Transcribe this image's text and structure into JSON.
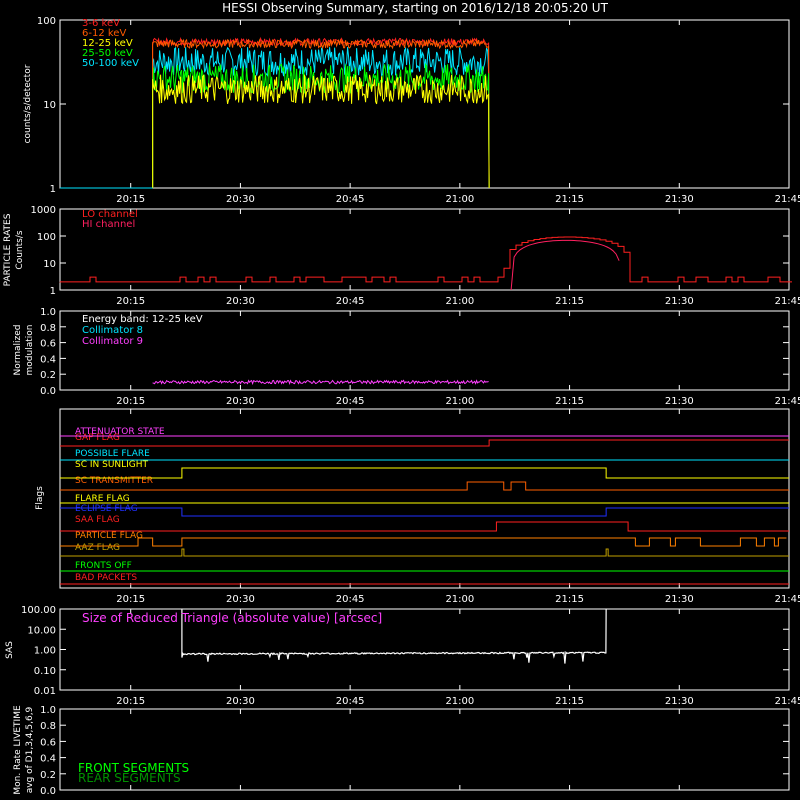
{
  "title": "HESSI Observing Summary, starting on 2016/12/18 20:05:20 UT",
  "colors": {
    "background": "#000000",
    "axes": "#ffffff",
    "e3_6": "#ff2020",
    "e6_12": "#ff5a00",
    "e12_25": "#ffff00",
    "e25_50": "#00ff00",
    "e50_100": "#00e5ff",
    "lo": "#ff2020",
    "hi": "#ff2060",
    "c8": "#00e5ff",
    "c9": "#ff40ff",
    "attenuator": "#ff40ff",
    "gap": "#ff2020",
    "flare_possible": "#00e5ff",
    "sunlight": "#ffff00",
    "transmitter": "#ff6000",
    "flare_flag": "#ffff00",
    "eclipse": "#2030ff",
    "saa": "#ff2020",
    "particle": "#ff8000",
    "aaz": "#c0a000",
    "fronts": "#00ff00",
    "bad": "#ff2020",
    "sas": "#ffffff",
    "sas_label": "#ff40ff",
    "front_seg": "#00ff00",
    "rear_seg": "#009000"
  },
  "time_axis": {
    "ticks": [
      "20:15",
      "20:30",
      "20:45",
      "21:00",
      "21:15",
      "21:30",
      "21:45"
    ]
  },
  "panels": {
    "counts": {
      "ylabel": "counts/s/detector",
      "yticks": [
        "1",
        "10",
        "100"
      ],
      "legend": [
        "3-6 keV",
        "6-12 keV",
        "12-25 keV",
        "25-50 keV",
        "50-100 keV"
      ]
    },
    "particle": {
      "ylabel1": "PARTICLE RATES",
      "ylabel2": "Counts/s",
      "yticks": [
        "1",
        "10",
        "100",
        "1000"
      ],
      "legend": [
        "LO channel",
        "HI channel"
      ]
    },
    "modulation": {
      "ylabel1": "Normalized",
      "ylabel2": "modulation",
      "yticks": [
        "0.0",
        "0.2",
        "0.4",
        "0.6",
        "0.8",
        "1.0"
      ],
      "legend": [
        "Energy band: 12-25 keV",
        "Collimator 8",
        "Collimator 9"
      ]
    },
    "flags": {
      "ylabel": "Flags",
      "names": [
        "ATTENUATOR STATE",
        "GAP FLAG",
        "POSSIBLE FLARE",
        "SC IN SUNLIGHT",
        "SC TRANSMITTER",
        "FLARE FLAG",
        "ECLIPSE FLAG",
        "SAA FLAG",
        "PARTICLE FLAG",
        "AAZ FLAG",
        "FRONTS OFF",
        "BAD PACKETS"
      ]
    },
    "sas": {
      "ylabel": "SAS",
      "yticks": [
        "0.01",
        "0.10",
        "1.00",
        "10.00",
        "100.00"
      ],
      "label": "Size of Reduced Triangle (absolute value) [arcsec]"
    },
    "livetime": {
      "ylabel1": "Mon. Rate LIVETIME",
      "ylabel2": "avg of D1,3,4,5,6,9",
      "yticks": [
        "0.0",
        "0.2",
        "0.4",
        "0.6",
        "0.8",
        "1.0"
      ],
      "legend": [
        "FRONT SEGMENTS",
        "REAR SEGMENTS"
      ]
    }
  },
  "chart_data": [
    {
      "type": "line",
      "title": "HESSI Observing Summary, starting on 2016/12/18 20:05:20 UT",
      "ylabel": "counts/s/detector",
      "yscale": "log",
      "ylim": [
        1,
        100
      ],
      "xlim": [
        "20:05:20",
        "21:45"
      ],
      "series": [
        {
          "name": "3-6 keV",
          "segments": [
            {
              "start": "20:18",
              "end": "21:04",
              "level": 55
            }
          ]
        },
        {
          "name": "6-12 keV",
          "segments": [
            {
              "start": "20:18",
              "end": "21:04",
              "level": 52
            }
          ]
        },
        {
          "name": "12-25 keV",
          "segments": [
            {
              "start": "20:18",
              "end": "21:04",
              "level": 15
            }
          ]
        },
        {
          "name": "25-50 keV",
          "segments": [
            {
              "start": "20:18",
              "end": "21:04",
              "level": 20
            }
          ]
        },
        {
          "name": "50-100 keV",
          "segments": [
            {
              "start": "20:18",
              "end": "21:04",
              "level": 32
            }
          ]
        }
      ]
    },
    {
      "type": "line",
      "ylabel": "PARTICLE RATES Counts/s",
      "yscale": "log",
      "ylim": [
        1,
        1000
      ],
      "series": [
        {
          "name": "LO channel",
          "points": [
            [
              "20:05",
              2
            ],
            [
              "21:03",
              2
            ],
            [
              "21:06",
              5
            ],
            [
              "21:08",
              40
            ],
            [
              "21:11",
              85
            ],
            [
              "21:15",
              90
            ],
            [
              "21:19",
              80
            ],
            [
              "21:22",
              10
            ],
            [
              "21:24",
              2
            ],
            [
              "21:45",
              2
            ]
          ]
        },
        {
          "name": "HI channel",
          "points": [
            [
              "21:06",
              1
            ],
            [
              "21:08",
              15
            ],
            [
              "21:11",
              60
            ],
            [
              "21:15",
              70
            ],
            [
              "21:19",
              60
            ],
            [
              "21:21",
              5
            ],
            [
              "21:22",
              1
            ]
          ]
        }
      ]
    },
    {
      "type": "line",
      "ylabel": "Normalized modulation",
      "ylim": [
        0,
        1
      ],
      "series": [
        {
          "name": "Collimator 8",
          "points": [
            [
              "20:18",
              0.1
            ],
            [
              "21:04",
              0.1
            ]
          ]
        },
        {
          "name": "Collimator 9",
          "points": [
            [
              "20:18",
              0.1
            ],
            [
              "21:04",
              0.1
            ]
          ]
        }
      ]
    },
    {
      "type": "line",
      "ylabel": "SAS",
      "yscale": "log",
      "ylim": [
        0.01,
        100
      ],
      "series": [
        {
          "name": "Size of Reduced Triangle (absolute value) [arcsec]",
          "points": [
            [
              "20:22",
              0.5
            ],
            [
              "20:30",
              0.6
            ],
            [
              "21:00",
              0.65
            ],
            [
              "21:20",
              0.65
            ]
          ]
        }
      ]
    },
    {
      "type": "line",
      "ylabel": "Mon. Rate LIVETIME avg of D1,3,4,5,6,9",
      "ylim": [
        0,
        1
      ],
      "series": []
    }
  ]
}
